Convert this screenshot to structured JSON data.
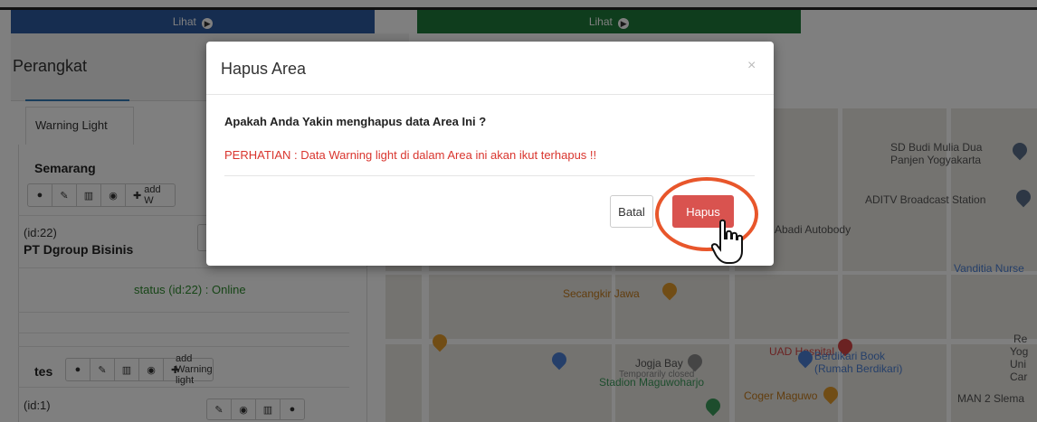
{
  "top_buttons": {
    "left_label": "Lihat",
    "right_label": "Lihat"
  },
  "left_panel": {
    "title": "Perangkat",
    "tab_label": "Warning Light",
    "groups": [
      {
        "name": "Semarang",
        "add_label": "add W",
        "item": {
          "id": "(id:22)",
          "name": "PT Dgroup Bisinis",
          "status": "status (id:22) : Online"
        }
      },
      {
        "name": "tes",
        "add_label": "add Warning light",
        "item": {
          "id": "(id:1)"
        }
      }
    ]
  },
  "map": {
    "labels": {
      "sd_budi": "SD Budi Mulia Dua",
      "panjen": "Panjen Yogyakarta",
      "aditv": "ADITV Broadcast Station",
      "abadi": "Abadi Autobody",
      "vanditia": "Vanditia Nurse",
      "secangkir": "Secangkir Jawa",
      "uad": "UAD Hospital",
      "jogja_bay": "Jogja Bay",
      "temp_closed": "Temporarily closed",
      "berdikari1": "Berdikari Book",
      "berdikari2": "(Rumah Berdikari)",
      "stadion": "Stadion Maguwoharjo",
      "coger": "Coger Maguwo",
      "man2": "MAN 2 Slema",
      "yog": "Yog",
      "uni": "Uni",
      "car": "Car",
      "re": "Re"
    },
    "colors": {
      "poi_blue": "#4a7fd4",
      "poi_red": "#d64545",
      "poi_orange": "#e39b2b",
      "poi_green": "#3a9a5a"
    }
  },
  "modal": {
    "title": "Hapus Area",
    "close_symbol": "×",
    "question": "Apakah Anda Yakin menghapus data Area Ini ?",
    "warning": "PERHATIAN : Data Warning light di dalam Area ini akan ikut terhapus !!",
    "cancel_label": "Batal",
    "confirm_label": "Hapus",
    "confirm_color": "#d9534f",
    "warning_color": "#d9352e",
    "highlight_color": "#e8562b"
  }
}
